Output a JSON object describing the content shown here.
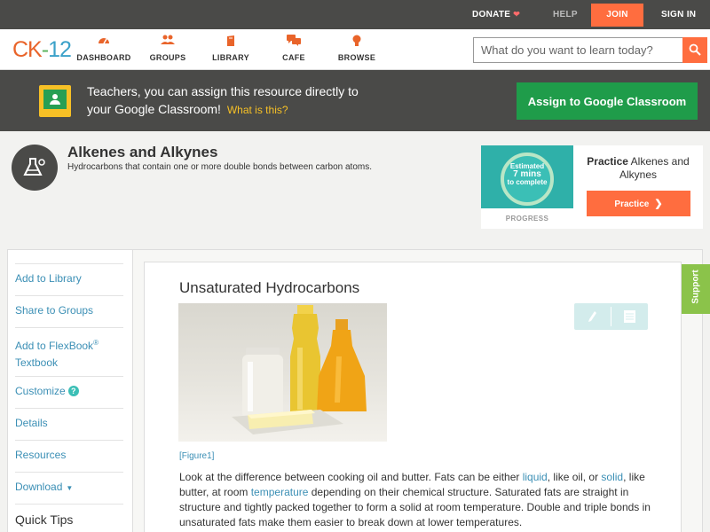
{
  "topbar": {
    "donate": "DONATE",
    "help": "HELP",
    "join": "JOIN",
    "signin": "SIGN IN"
  },
  "header": {
    "logo": {
      "ck": "CK",
      "dash": "-",
      "num": "12"
    },
    "nav": {
      "dashboard": "DASHBOARD",
      "groups": "GROUPS",
      "library": "LIBRARY",
      "cafe": "CAFE",
      "browse": "BROWSE"
    },
    "search_placeholder": "What do you want to learn today?"
  },
  "banner": {
    "line1": "Teachers, you can assign this resource directly to",
    "line2": "your Google Classroom!",
    "what_link": "What is this?",
    "assign_button": "Assign to Google Classroom"
  },
  "concept": {
    "title": "Alkenes and Alkynes",
    "description": "Hydrocarbons that contain one or more double bonds between carbon atoms."
  },
  "practice_card": {
    "estimated": "Estimated",
    "minutes": "7 mins",
    "to_complete": "to complete",
    "progress_label": "PROGRESS",
    "practice_word": "Practice",
    "practice_topic": "Alkenes and Alkynes",
    "button": "Practice"
  },
  "sidebar": {
    "add_library": "Add to Library",
    "share_groups": "Share to Groups",
    "add_flexbook_1": "Add to FlexBook",
    "add_flexbook_sup": "®",
    "add_flexbook_2": "Textbook",
    "customize": "Customize",
    "customize_help": "?",
    "details": "Details",
    "resources": "Resources",
    "download": "Download",
    "quick_tips": "Quick Tips"
  },
  "content": {
    "section_title": "Unsaturated Hydrocarbons",
    "figure_label": "[Figure1]",
    "para": {
      "t1": "Look at the difference between cooking oil and butter. Fats can be either ",
      "liquid": "liquid",
      "t2": ", like oil, or ",
      "solid": "solid",
      "t3": ", like butter, at room ",
      "temperature": "temperature",
      "t4": " depending on their chemical structure. Saturated fats are straight in structure and tightly packed together to form a solid at room temperature. Double and triple bonds in unsaturated fats make them easier to break down at lower temperatures."
    }
  },
  "support_tab": "Support",
  "colors": {
    "accent_orange": "#ff6d3f",
    "google_green": "#1f9c4a",
    "link_blue": "#3b8fb5",
    "dark_bar": "#4a4a48",
    "support_green": "#8bc34a"
  }
}
